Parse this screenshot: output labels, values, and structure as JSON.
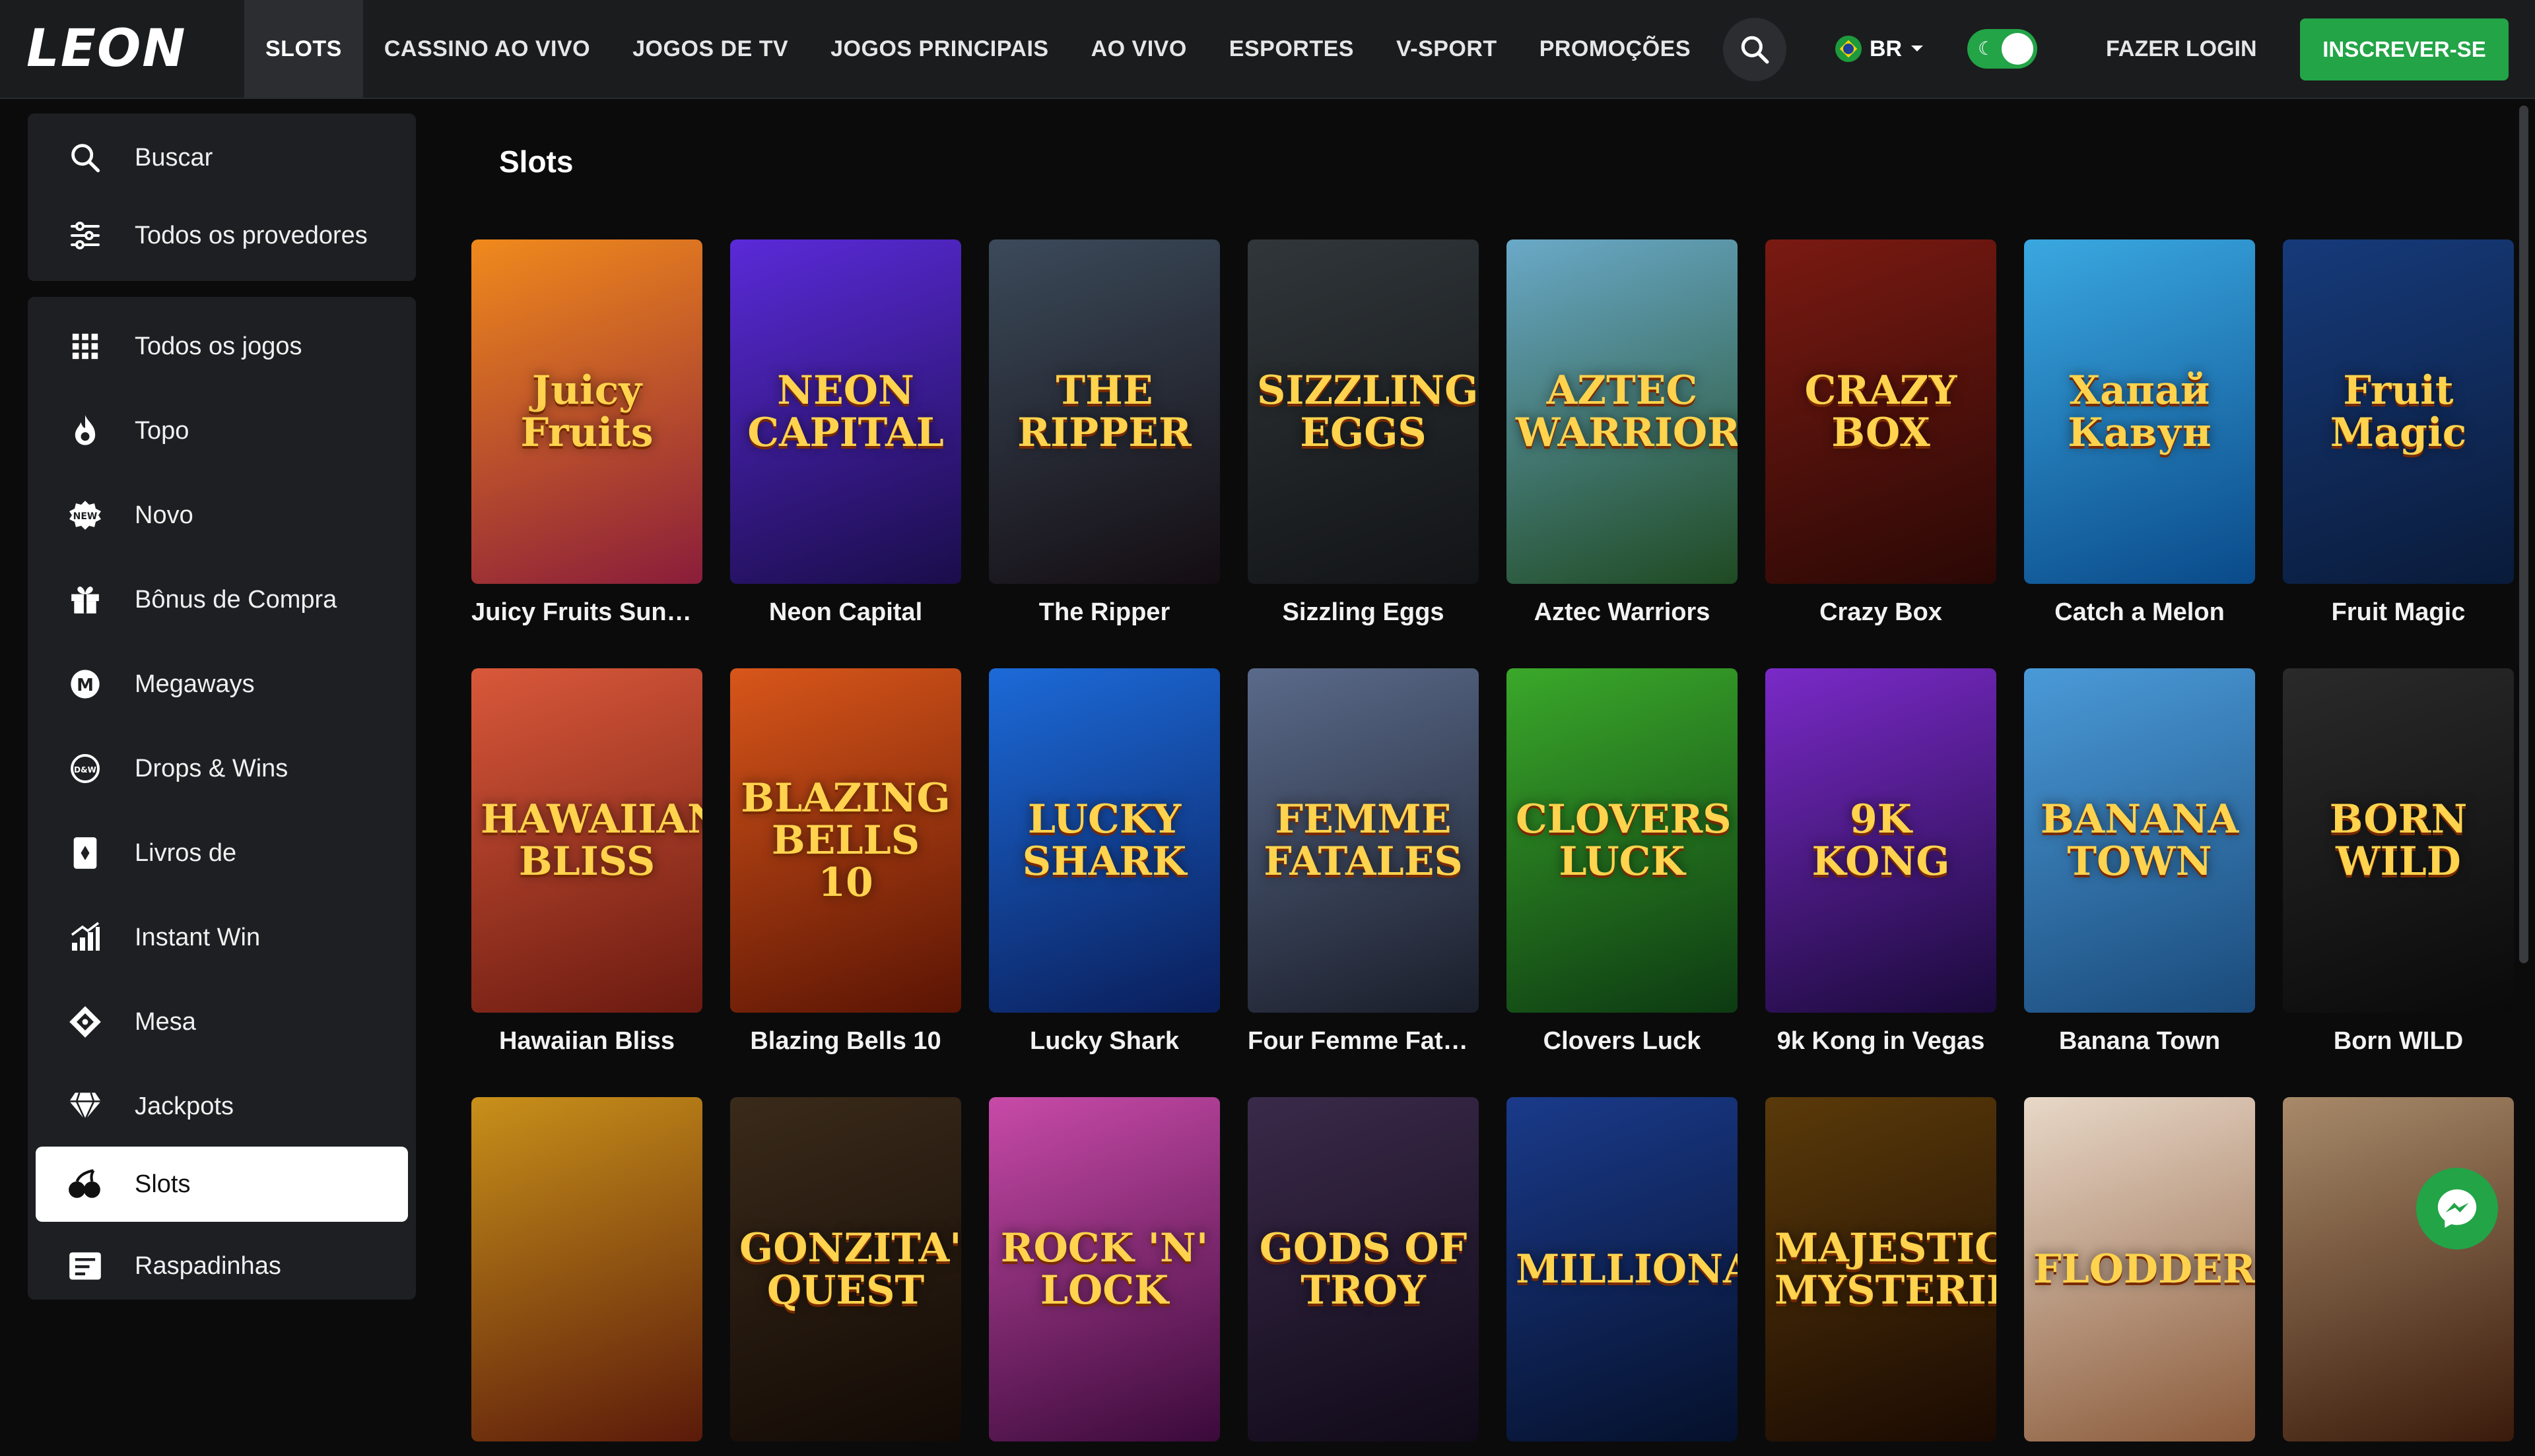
{
  "header": {
    "logo": "LEON",
    "nav": [
      "SLOTS",
      "CASSINO AO VIVO",
      "JOGOS DE TV",
      "JOGOS PRINCIPAIS",
      "AO VIVO",
      "ESPORTES",
      "V-SPORT",
      "PROMOÇÕES"
    ],
    "more": "•••",
    "lang": "BR",
    "login": "FAZER LOGIN",
    "signup": "INSCREVER-SE",
    "colors": {
      "bar": "#1b1c1e",
      "accent": "#22a447"
    }
  },
  "sidebar": {
    "top": [
      {
        "label": "Buscar",
        "icon": "search-icon"
      },
      {
        "label": "Todos os provedores",
        "icon": "sliders-icon"
      }
    ],
    "items": [
      {
        "label": "Todos os jogos",
        "icon": "grid-icon"
      },
      {
        "label": "Topo",
        "icon": "flame-icon"
      },
      {
        "label": "Novo",
        "icon": "new-badge-icon"
      },
      {
        "label": "Bônus de Compra",
        "icon": "gift-icon"
      },
      {
        "label": "Megaways",
        "icon": "megaways-icon"
      },
      {
        "label": "Drops & Wins",
        "icon": "drops-wins-icon"
      },
      {
        "label": "Livros de",
        "icon": "book-icon"
      },
      {
        "label": "Instant Win",
        "icon": "bar-chart-icon"
      },
      {
        "label": "Mesa",
        "icon": "table-game-icon"
      },
      {
        "label": "Jackpots",
        "icon": "diamond-icon"
      },
      {
        "label": "Slots",
        "icon": "cherries-icon"
      },
      {
        "label": "Raspadinhas",
        "icon": "scratch-card-icon"
      }
    ],
    "active": "Slots"
  },
  "main": {
    "title": "Slots",
    "games": [
      {
        "name": "Juicy Fruits Sunsh…",
        "art": "Juicy Fruits",
        "bg": [
          "#f08a1c",
          "#8a1d3a"
        ]
      },
      {
        "name": "Neon Capital",
        "art": "NEON CAPITAL",
        "bg": [
          "#5a2ad8",
          "#1a0d4a"
        ]
      },
      {
        "name": "The Ripper",
        "art": "THE RIPPER",
        "bg": [
          "#3b4a5a",
          "#140d12"
        ]
      },
      {
        "name": "Sizzling Eggs",
        "art": "SIZZLING EGGS",
        "bg": [
          "#30363a",
          "#121416"
        ]
      },
      {
        "name": "Aztec Warriors",
        "art": "AZTEC WARRIORS",
        "bg": [
          "#6aa9c8",
          "#1f4a22"
        ]
      },
      {
        "name": "Crazy Box",
        "art": "CRAZY BOX",
        "bg": [
          "#7a1a12",
          "#2a0805"
        ]
      },
      {
        "name": "Catch a Melon",
        "art": "Хапай Кавун",
        "bg": [
          "#3aa8e0",
          "#0a4a8a"
        ]
      },
      {
        "name": "Fruit Magic",
        "art": "Fruit Magic",
        "bg": [
          "#163a7a",
          "#0a1b3a"
        ]
      },
      {
        "name": "Hawaiian Bliss",
        "art": "HAWAIIAN BLISS",
        "bg": [
          "#d9583a",
          "#6a1a10"
        ]
      },
      {
        "name": "Blazing Bells 10",
        "art": "BLAZING BELLS 10",
        "bg": [
          "#d8561a",
          "#5a1404"
        ]
      },
      {
        "name": "Lucky Shark",
        "art": "LUCKY SHARK",
        "bg": [
          "#1c6ad8",
          "#0a1e5a"
        ]
      },
      {
        "name": "Four Femme Fatal…",
        "art": "FEMME FATALES",
        "bg": [
          "#5a6a8a",
          "#1a1e2a"
        ]
      },
      {
        "name": "Clovers Luck",
        "art": "CLOVERS LUCK",
        "bg": [
          "#3aa82a",
          "#0d3a12"
        ]
      },
      {
        "name": "9k Kong in Vegas",
        "art": "9K KONG",
        "bg": [
          "#7a2ac8",
          "#1a0a3a"
        ]
      },
      {
        "name": "Banana Town",
        "art": "BANANA TOWN",
        "bg": [
          "#4a9ad8",
          "#1a4a7a"
        ]
      },
      {
        "name": "Born WILD",
        "art": "BORN WILD",
        "bg": [
          "#2a2a2a",
          "#0a0a0a"
        ]
      },
      {
        "name": "",
        "art": "",
        "bg": [
          "#c8901a",
          "#5a1a0a"
        ]
      },
      {
        "name": "",
        "art": "GONZITA'S QUEST",
        "bg": [
          "#3a2a1a",
          "#120a05"
        ]
      },
      {
        "name": "",
        "art": "ROCK 'N' LOCK",
        "bg": [
          "#c84aa8",
          "#3a0a3a"
        ]
      },
      {
        "name": "",
        "art": "GODS OF TROY",
        "bg": [
          "#3a2a4a",
          "#100a18"
        ]
      },
      {
        "name": "",
        "art": "MILLIONAIRE",
        "bg": [
          "#1a3a8a",
          "#05102a"
        ]
      },
      {
        "name": "",
        "art": "MAJESTIC MYSTERIES",
        "bg": [
          "#5a3a0a",
          "#1a0a02"
        ]
      },
      {
        "name": "",
        "art": "FLODDER",
        "bg": [
          "#e8d8c8",
          "#8a5a3a"
        ]
      },
      {
        "name": "",
        "art": "",
        "bg": [
          "#a88a6a",
          "#3a1a0a"
        ]
      }
    ]
  }
}
